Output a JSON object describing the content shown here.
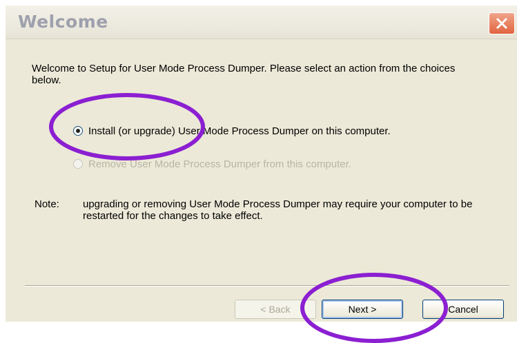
{
  "window": {
    "title": "Welcome",
    "close_icon": "close-icon"
  },
  "body": {
    "intro": "Welcome to Setup for User Mode Process Dumper. Please select an action from the choices below.",
    "options": [
      {
        "label": "Install (or upgrade) User Mode Process Dumper on this computer.",
        "selected": true,
        "enabled": true
      },
      {
        "label": "Remove User Mode Process Dumper from this computer.",
        "selected": false,
        "enabled": false
      }
    ],
    "note_label": "Note:",
    "note_text": "upgrading or removing User Mode Process Dumper may require your computer to be restarted for the changes to take effect."
  },
  "buttons": {
    "back": "< Back",
    "next": "Next >",
    "cancel": "Cancel"
  },
  "colors": {
    "highlight_circle": "#8b1fd1",
    "panel": "#ece9d8",
    "close_button": "#e2643f"
  }
}
